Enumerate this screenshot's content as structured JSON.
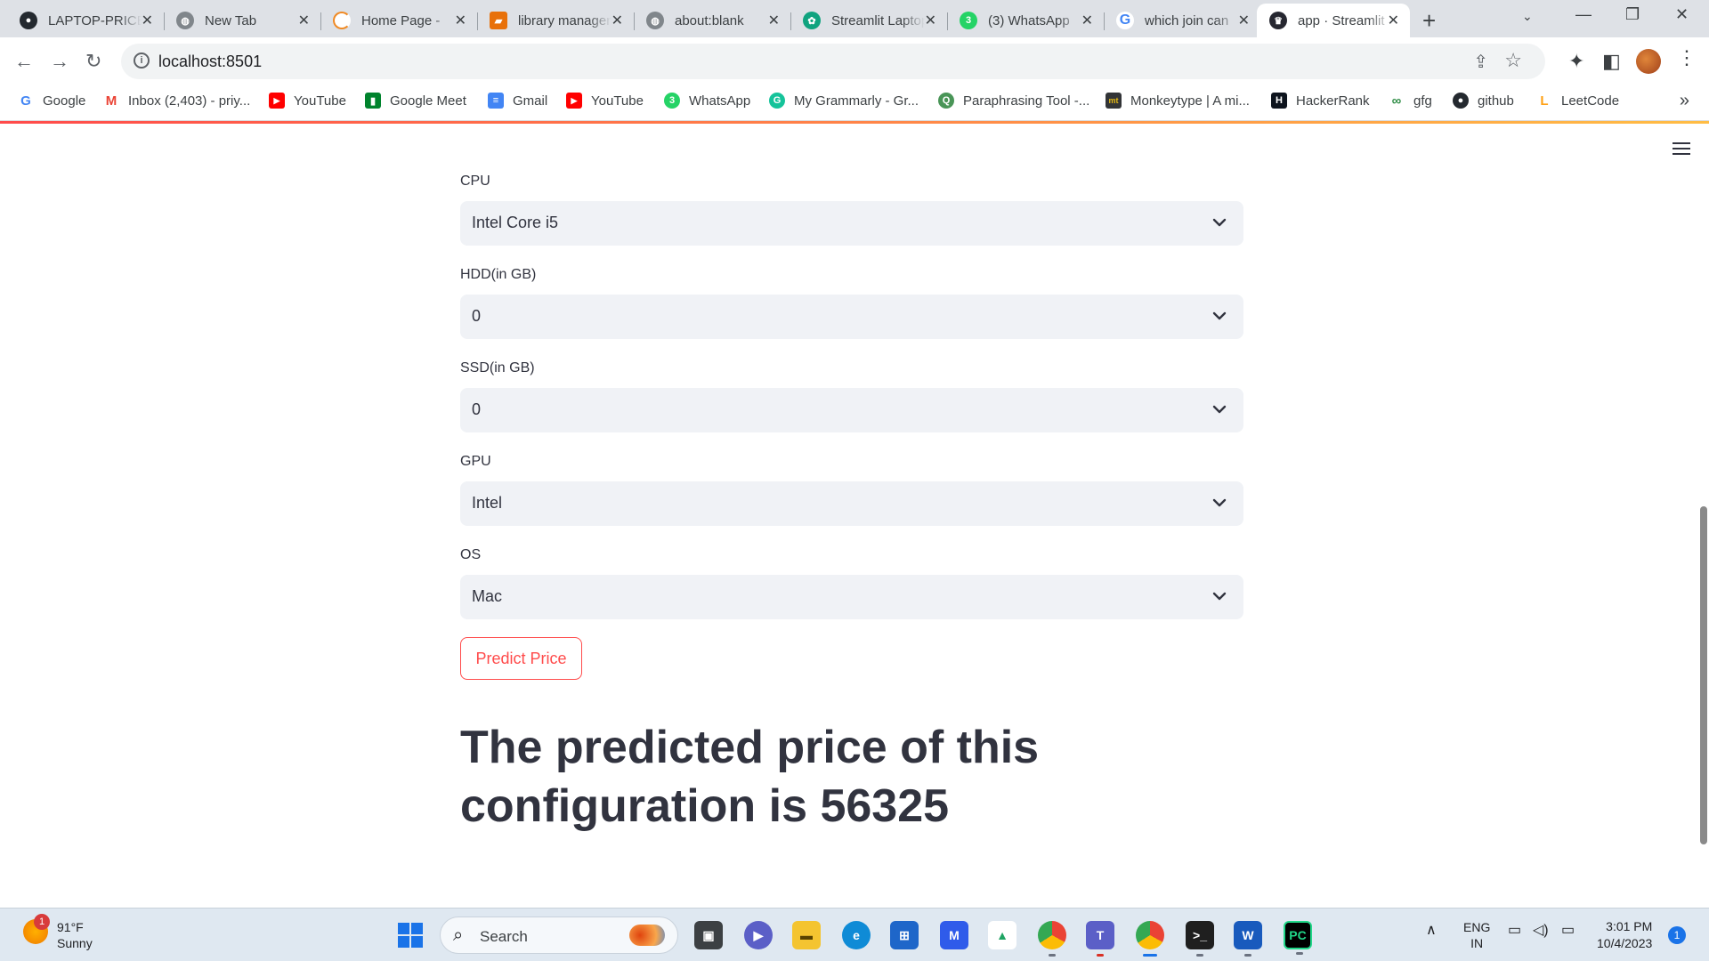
{
  "browser": {
    "tabs": [
      {
        "title": "LAPTOP-PRICE-PREDICTOR",
        "icon": "github-icon",
        "color": "#24292f"
      },
      {
        "title": "New Tab",
        "icon": "globe-icon",
        "color": "#5f6368"
      },
      {
        "title": "Home Page - ",
        "icon": "spinner-icon",
        "color": "#f08a24"
      },
      {
        "title": "library management",
        "icon": "document-icon",
        "color": "#e8710a"
      },
      {
        "title": "about:blank",
        "icon": "globe-icon",
        "color": "#5f6368"
      },
      {
        "title": "Streamlit Laptop",
        "icon": "chatgpt-icon",
        "color": "#10a37f"
      },
      {
        "title": "(3) WhatsApp",
        "icon": "whatsapp-icon",
        "color": "#25d366"
      },
      {
        "title": "which join can",
        "icon": "google-icon",
        "color": "#4285f4"
      },
      {
        "title": "app · Streamlit",
        "icon": "streamlit-icon",
        "color": "#262730"
      }
    ],
    "url": "localhost:8501"
  },
  "bookmarks": [
    {
      "label": "Google",
      "icon": "google-icon",
      "color": "#4285f4",
      "glyph": "G"
    },
    {
      "label": "Inbox (2,403) - priy...",
      "icon": "gmail-icon",
      "color": "#ea4335",
      "glyph": "M"
    },
    {
      "label": "YouTube",
      "icon": "youtube-icon",
      "color": "#ff0000",
      "glyph": "▶"
    },
    {
      "label": "Google Meet",
      "icon": "meet-icon",
      "color": "#00832d",
      "glyph": "▮"
    },
    {
      "label": "Gmail",
      "icon": "docs-icon",
      "color": "#4285f4",
      "glyph": "≡"
    },
    {
      "label": "YouTube",
      "icon": "youtube-icon",
      "color": "#ff0000",
      "glyph": "▶"
    },
    {
      "label": "WhatsApp",
      "icon": "whatsapp-icon",
      "color": "#25d366",
      "glyph": "3"
    },
    {
      "label": "My Grammarly - Gr...",
      "icon": "grammarly-icon",
      "color": "#15c39a",
      "glyph": "G"
    },
    {
      "label": "Paraphrasing Tool -...",
      "icon": "quillbot-icon",
      "color": "#499557",
      "glyph": "Q"
    },
    {
      "label": "Monkeytype | A mi...",
      "icon": "monkeytype-icon",
      "color": "#323437",
      "glyph": "mt"
    },
    {
      "label": "HackerRank",
      "icon": "hackerrank-icon",
      "color": "#0e141e",
      "glyph": "H"
    },
    {
      "label": "gfg",
      "icon": "gfg-icon",
      "color": "#2f8d46",
      "glyph": "∞"
    },
    {
      "label": "github",
      "icon": "github-icon",
      "color": "#24292f",
      "glyph": "●"
    },
    {
      "label": "LeetCode",
      "icon": "leetcode-icon",
      "color": "#ffa116",
      "glyph": "L"
    }
  ],
  "form": {
    "fields": [
      {
        "label": "CPU",
        "value": "Intel Core i5"
      },
      {
        "label": "HDD(in GB)",
        "value": "0"
      },
      {
        "label": "SSD(in GB)",
        "value": "0"
      },
      {
        "label": "GPU",
        "value": "Intel"
      },
      {
        "label": "OS",
        "value": "Mac"
      }
    ],
    "button_label": "Predict Price",
    "result": "The predicted price of this configuration is 56325"
  },
  "colors": {
    "accent": "#ff4b4b",
    "select_bg": "#f0f2f6",
    "text": "#31333f"
  },
  "taskbar": {
    "weather": {
      "temp": "91°F",
      "condition": "Sunny",
      "badge": "1"
    },
    "search_label": "Search",
    "language": {
      "line1": "ENG",
      "line2": "IN"
    },
    "time": "3:01 PM",
    "date": "10/4/2023",
    "notifications": "1"
  }
}
